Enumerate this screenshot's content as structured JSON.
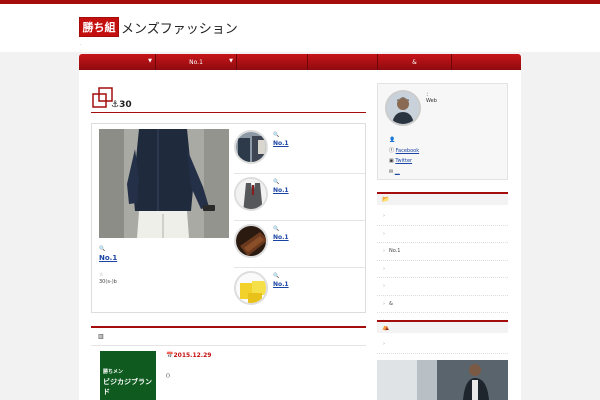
{
  "site": {
    "logo_badge": "勝ち組",
    "logo_text": "メンズファッション",
    "tagline": "·"
  },
  "nav": {
    "items": [
      {
        "label": ""
      },
      {
        "label": "No.1"
      },
      {
        "label": ""
      },
      {
        "label": ""
      },
      {
        "label": "&"
      },
      {
        "label": ""
      }
    ]
  },
  "main": {
    "title": "⚓30",
    "featured": {
      "tag_icon": "🔍",
      "title": "No.1",
      "date_icon": "☆",
      "desc": "30(s-)b"
    },
    "side_items": [
      {
        "tag_icon": "🔍",
        "title": "No.1"
      },
      {
        "tag_icon": "🔍",
        "title": "No.1"
      },
      {
        "tag_icon": "🔍",
        "title": "No.1"
      },
      {
        "tag_icon": "🔍",
        "title": "No.1"
      }
    ]
  },
  "section2": {
    "icon": "▥",
    "book_line1": "勝ちメン",
    "book_line2": "ビジカジブランド",
    "date": "📅2015.12.29",
    "excerpt": "()"
  },
  "sidebar": {
    "profile_line1": "：",
    "profile_line2": "Web",
    "links": [
      {
        "icon": "👤",
        "label": ""
      },
      {
        "icon": "ⓕ",
        "label": "Facebook"
      },
      {
        "icon": "▣",
        "label": "Twitter"
      },
      {
        "icon": "✉",
        "label": "＿"
      }
    ],
    "categories_icon": "📂",
    "categories": [
      {
        "label": ""
      },
      {
        "label": ""
      },
      {
        "label": "No.1"
      },
      {
        "label": ""
      },
      {
        "label": ""
      },
      {
        "label": "&"
      },
      {
        "label": ""
      }
    ],
    "widget2_icon": "⛺",
    "widget2_items": [
      {
        "label": ""
      }
    ]
  }
}
